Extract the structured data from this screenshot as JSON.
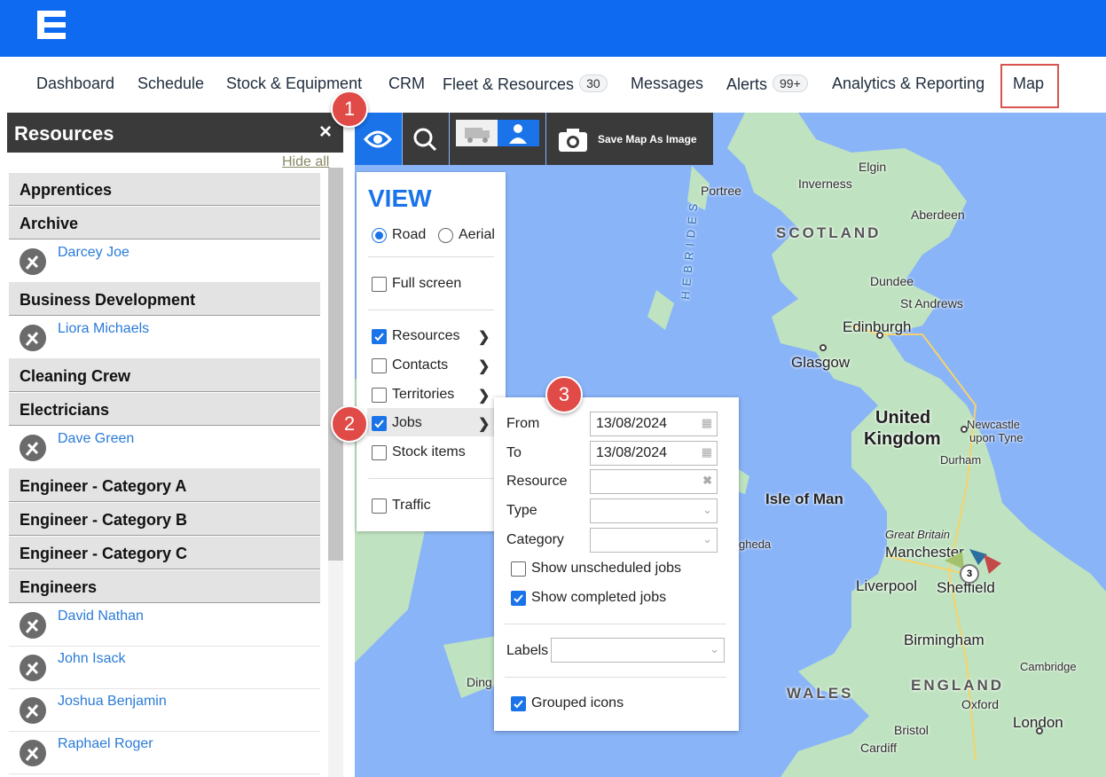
{
  "colors": {
    "brand_blue": "#0f6af2",
    "accent_blue": "#1a73e8",
    "callout_red": "#e04a47",
    "map_water": "#8ab4f8",
    "map_land": "#bfe3c0"
  },
  "nav": {
    "items": [
      {
        "label": "Dashboard"
      },
      {
        "label": "Schedule"
      },
      {
        "label": "Stock & Equipment"
      },
      {
        "label": "CRM"
      },
      {
        "label": "Fleet & Resources",
        "badge": "30"
      },
      {
        "label": "Messages"
      },
      {
        "label": "Alerts",
        "badge": "99+"
      },
      {
        "label": "Analytics & Reporting"
      },
      {
        "label": "Map"
      }
    ]
  },
  "callouts": [
    "1",
    "2",
    "3"
  ],
  "resources": {
    "title": "Resources",
    "close_icon": "×",
    "hide_all": "Hide all",
    "groups": [
      {
        "name": "Apprentices"
      },
      {
        "name": "Archive",
        "people": [
          "Darcey Joe"
        ]
      },
      {
        "name": "Business Development",
        "people": [
          "Liora Michaels"
        ]
      },
      {
        "name": "Cleaning Crew"
      },
      {
        "name": "Electricians",
        "people": [
          "Dave Green"
        ]
      },
      {
        "name": "Engineer - Category A"
      },
      {
        "name": "Engineer - Category B"
      },
      {
        "name": "Engineer - Category C"
      },
      {
        "name": "Engineers",
        "people": [
          "David Nathan",
          "John Isack",
          "Joshua Benjamin",
          "Raphael Roger"
        ]
      }
    ]
  },
  "toolbar": {
    "save_label": "Save Map As Image",
    "icons": [
      "eye-icon",
      "search-icon",
      "vehicle-icon",
      "person-icon",
      "camera-icon"
    ]
  },
  "view": {
    "title": "VIEW",
    "road": "Road",
    "aerial": "Aerial",
    "full_screen": "Full screen",
    "resources": "Resources",
    "contacts": "Contacts",
    "territories": "Territories",
    "jobs": "Jobs",
    "stock_items": "Stock items",
    "traffic": "Traffic"
  },
  "jobs": {
    "from_label": "From",
    "from_value": "13/08/2024",
    "to_label": "To",
    "to_value": "13/08/2024",
    "resource_label": "Resource",
    "type_label": "Type",
    "category_label": "Category",
    "show_unscheduled": "Show unscheduled jobs",
    "show_completed": "Show completed jobs",
    "labels_label": "Labels",
    "grouped_icons": "Grouped icons"
  },
  "map": {
    "labels": {
      "portree": "Portree",
      "inverness": "Inverness",
      "elgin": "Elgin",
      "aberdeen": "Aberdeen",
      "hebrides": "HEBRIDES",
      "scotland": "SCOTLAND",
      "dundee": "Dundee",
      "st_andrews": "St Andrews",
      "edinburgh": "Edinburgh",
      "glasgow": "Glasgow",
      "uk_line1": "United",
      "uk_line2": "Kingdom",
      "newcastle_1": "Newcastle",
      "newcastle_2": "upon Tyne",
      "durham": "Durham",
      "isle_of_man": "Isle of Man",
      "drogheda": "gheda",
      "great_britain": "Great Britain",
      "manchester": "Manchester",
      "liverpool": "Liverpool",
      "sheffield": "Sheffield",
      "birmingham": "Birmingham",
      "cambridge": "Cambridge",
      "wales": "WALES",
      "england": "ENGLAND",
      "oxford": "Oxford",
      "dingle": "Ding",
      "bristol": "Bristol",
      "cardiff": "Cardiff",
      "london": "London"
    },
    "cluster_count": "3"
  }
}
